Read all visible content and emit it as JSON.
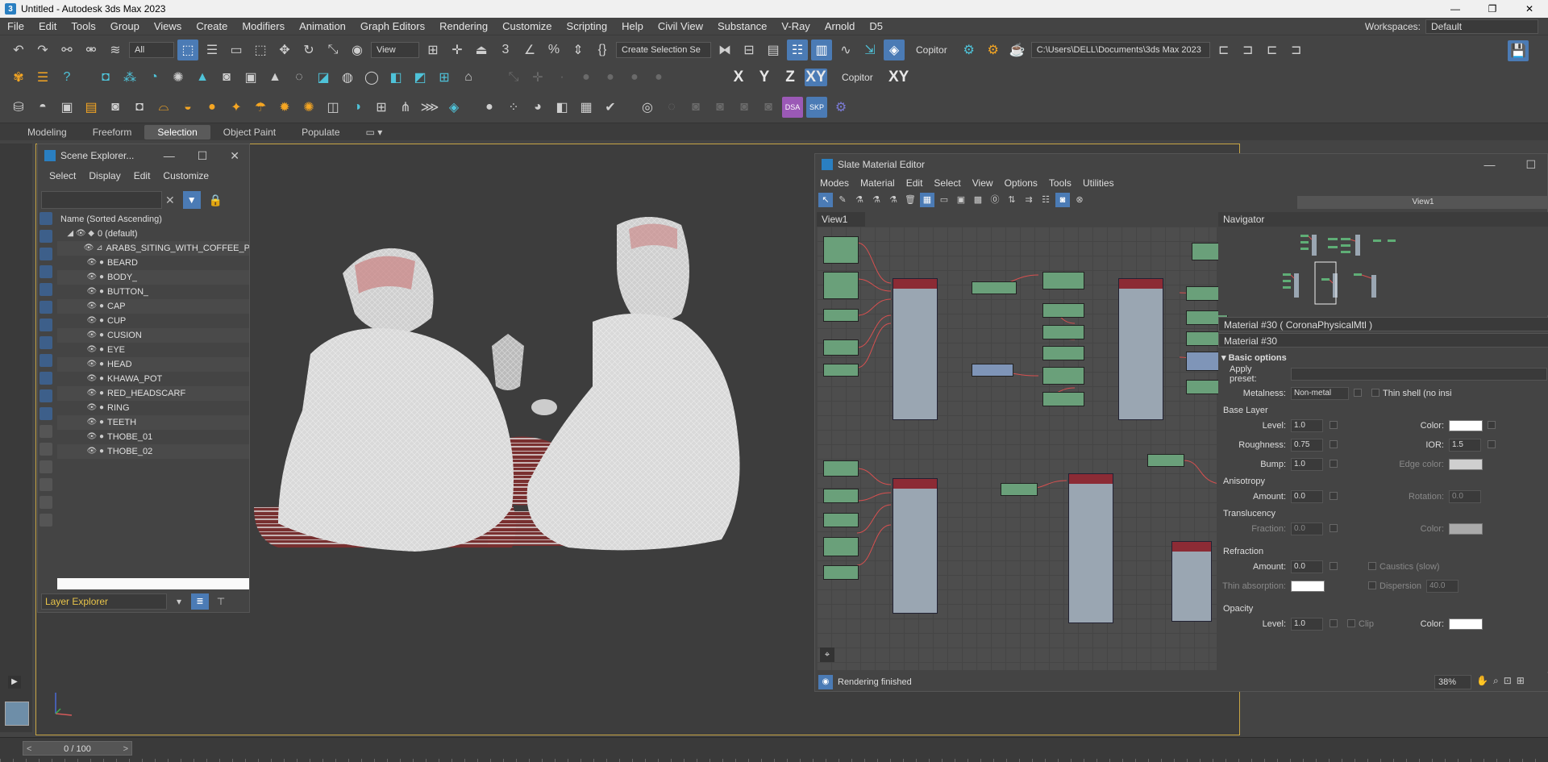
{
  "window": {
    "title": "Untitled - Autodesk 3ds Max 2023",
    "minimize": "—",
    "maximize": "❐",
    "close": "✕"
  },
  "menu": [
    "File",
    "Edit",
    "Tools",
    "Group",
    "Views",
    "Create",
    "Modifiers",
    "Animation",
    "Graph Editors",
    "Rendering",
    "Customize",
    "Scripting",
    "Help",
    "Civil View",
    "Substance",
    "V-Ray",
    "Arnold",
    "D5"
  ],
  "workspaces": {
    "label": "Workspaces:",
    "value": "Default"
  },
  "toolbar": {
    "selection_filter": "All",
    "ref_coord": "View",
    "named_selection": "Create Selection Se",
    "copitor": "Copitor",
    "project_path": "C:\\Users\\DELL\\Documents\\3ds Max 2023"
  },
  "axis_bar": {
    "x": "X",
    "y": "Y",
    "z": "Z",
    "xy": "XY",
    "copitor": "Copitor",
    "xyflip": "XY"
  },
  "ribbon_tabs": [
    "Modeling",
    "Freeform",
    "Selection",
    "Object Paint",
    "Populate"
  ],
  "ribbon_active": "Selection",
  "scene_explorer": {
    "title": "Scene Explorer...",
    "menu": [
      "Select",
      "Display",
      "Edit",
      "Customize"
    ],
    "column_header": "Name (Sorted Ascending)",
    "root": "0 (default)",
    "items": [
      "ARABS_SITING_WITH_COFFEE_PO",
      "BEARD",
      "BODY_",
      "BUTTON_",
      "CAP",
      "CUP",
      "CUSION",
      "EYE",
      "HEAD",
      "KHAWA_POT",
      "RED_HEADSCARF",
      "RING",
      "TEETH",
      "THOBE_01",
      "THOBE_02"
    ],
    "footer": "Layer Explorer"
  },
  "slate": {
    "title": "Slate Material Editor",
    "menu": [
      "Modes",
      "Material",
      "Edit",
      "Select",
      "View",
      "Options",
      "Tools",
      "Utilities"
    ],
    "view_tab": "View1",
    "view_right": "View1",
    "navigator": "Navigator",
    "material_name_bar": "Material #30  ( CoronaPhysicalMtl )",
    "material_name": "Material #30",
    "status": "Rendering finished",
    "zoom": "38%",
    "props": {
      "section_basic": "Basic options",
      "apply_preset": "Apply preset:",
      "metalness": "Metalness:",
      "metalness_value": "Non-metal",
      "thin_shell": "Thin shell (no insi",
      "base_layer": "Base Layer",
      "level": "Level:",
      "level_value": "1.0",
      "color": "Color:",
      "roughness": "Roughness:",
      "roughness_value": "0.75",
      "ior": "IOR:",
      "ior_value": "1.5",
      "bump": "Bump:",
      "bump_value": "1.0",
      "edge_color": "Edge color:",
      "anisotropy": "Anisotropy",
      "amount": "Amount:",
      "amount_value": "0.0",
      "rotation": "Rotation:",
      "rotation_value": "0.0",
      "translucency": "Translucency",
      "fraction": "Fraction:",
      "fraction_value": "0.0",
      "refraction": "Refraction",
      "ref_amount_value": "0.0",
      "caustics": "Caustics (slow)",
      "thin_absorption": "Thin absorption:",
      "dispersion": "Dispersion",
      "dispersion_value": "40.0",
      "opacity": "Opacity",
      "op_level_value": "1.0",
      "clip": "Clip"
    }
  },
  "timeline": {
    "frame": "0 / 100"
  },
  "colors": {
    "accent": "#4b7bb5",
    "viewport_border": "#c8a645",
    "layer_text": "#e8c44a"
  }
}
